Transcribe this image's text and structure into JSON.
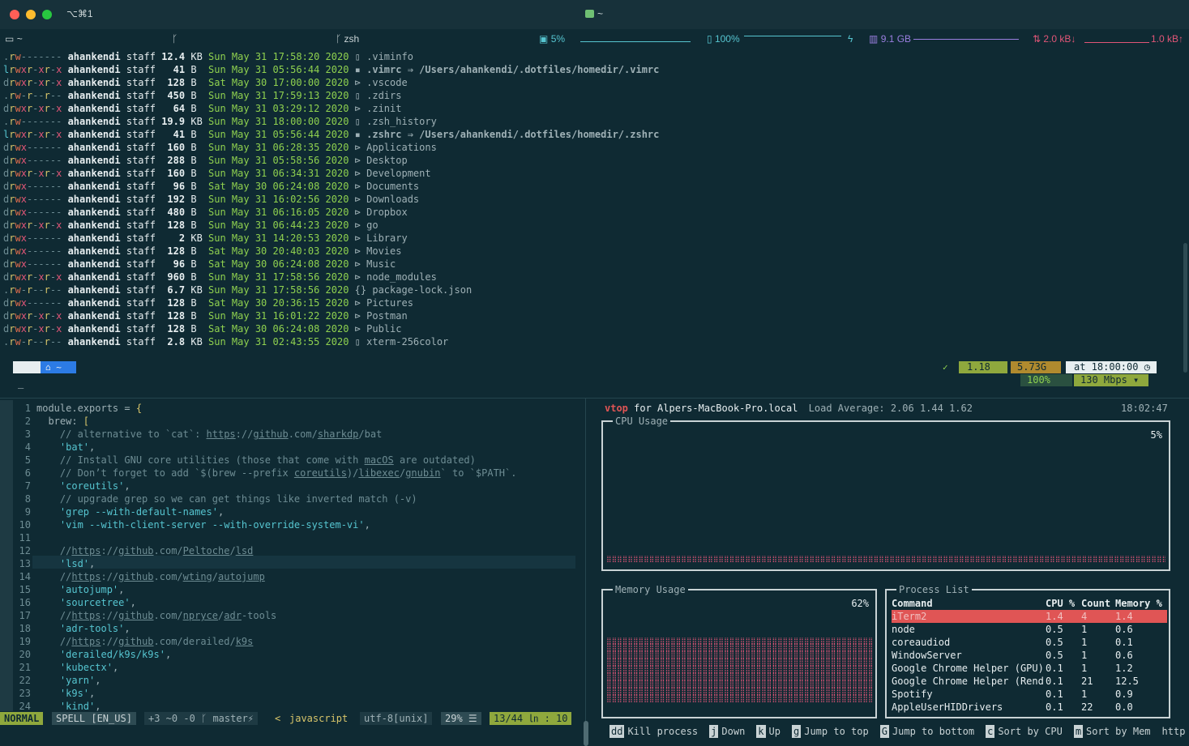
{
  "window": {
    "shortcut": "⌥⌘1",
    "title": "~"
  },
  "statusbar": {
    "cwd": "~",
    "shell": "zsh",
    "cpu": "5%",
    "battery": "100%",
    "memory": "9.1 GB",
    "net_down": "2.0 kB↓",
    "net_up": "1.0 kB↑",
    "colors": {
      "cpu": "#56c5d0",
      "battery": "#56c5d0",
      "memory": "#9a7fe0",
      "net": "#e05577"
    }
  },
  "listing": [
    {
      "perm": ".rw-------",
      "user": "ahankendi",
      "group": "staff",
      "size": "12.4",
      "unit": "KB",
      "date": "Sun May 31 17:58:20 2020",
      "icon": "file-icon",
      "name": ".viminfo",
      "target": ""
    },
    {
      "perm": "lrwxr-xr-x",
      "user": "ahankendi",
      "group": "staff",
      "size": "41",
      "unit": "B",
      "date": "Sun May 31 05:56:44 2020",
      "icon": "link-icon",
      "name": ".vimrc",
      "target": "⇒ /Users/ahankendi/.dotfiles/homedir/.vimrc"
    },
    {
      "perm": "drwxr-xr-x",
      "user": "ahankendi",
      "group": "staff",
      "size": "128",
      "unit": "B",
      "date": "Sat May 30 17:00:00 2020",
      "icon": "folder-icon",
      "name": ".vscode",
      "target": ""
    },
    {
      "perm": ".rw-r--r--",
      "user": "ahankendi",
      "group": "staff",
      "size": "450",
      "unit": "B",
      "date": "Sun May 31 17:59:13 2020",
      "icon": "file-icon",
      "name": ".zdirs",
      "target": ""
    },
    {
      "perm": "drwxr-xr-x",
      "user": "ahankendi",
      "group": "staff",
      "size": "64",
      "unit": "B",
      "date": "Sun May 31 03:29:12 2020",
      "icon": "folder-icon",
      "name": ".zinit",
      "target": ""
    },
    {
      "perm": ".rw-------",
      "user": "ahankendi",
      "group": "staff",
      "size": "19.9",
      "unit": "KB",
      "date": "Sun May 31 18:00:00 2020",
      "icon": "file-icon",
      "name": ".zsh_history",
      "target": ""
    },
    {
      "perm": "lrwxr-xr-x",
      "user": "ahankendi",
      "group": "staff",
      "size": "41",
      "unit": "B",
      "date": "Sun May 31 05:56:44 2020",
      "icon": "link-icon",
      "name": ".zshrc",
      "target": "⇒ /Users/ahankendi/.dotfiles/homedir/.zshrc"
    },
    {
      "perm": "drwx------",
      "user": "ahankendi",
      "group": "staff",
      "size": "160",
      "unit": "B",
      "date": "Sun May 31 06:28:35 2020",
      "icon": "folder-icon",
      "name": "Applications",
      "target": ""
    },
    {
      "perm": "drwx------",
      "user": "ahankendi",
      "group": "staff",
      "size": "288",
      "unit": "B",
      "date": "Sun May 31 05:58:56 2020",
      "icon": "folder-icon",
      "name": "Desktop",
      "target": ""
    },
    {
      "perm": "drwxr-xr-x",
      "user": "ahankendi",
      "group": "staff",
      "size": "160",
      "unit": "B",
      "date": "Sun May 31 06:34:31 2020",
      "icon": "folder-icon",
      "name": "Development",
      "target": ""
    },
    {
      "perm": "drwx------",
      "user": "ahankendi",
      "group": "staff",
      "size": "96",
      "unit": "B",
      "date": "Sat May 30 06:24:08 2020",
      "icon": "folder-icon",
      "name": "Documents",
      "target": ""
    },
    {
      "perm": "drwx------",
      "user": "ahankendi",
      "group": "staff",
      "size": "192",
      "unit": "B",
      "date": "Sun May 31 16:02:56 2020",
      "icon": "folder-icon",
      "name": "Downloads",
      "target": ""
    },
    {
      "perm": "drwx------",
      "user": "ahankendi",
      "group": "staff",
      "size": "480",
      "unit": "B",
      "date": "Sun May 31 06:16:05 2020",
      "icon": "folder-icon",
      "name": "Dropbox",
      "target": ""
    },
    {
      "perm": "drwxr-xr-x",
      "user": "ahankendi",
      "group": "staff",
      "size": "128",
      "unit": "B",
      "date": "Sun May 31 06:44:23 2020",
      "icon": "folder-icon",
      "name": "go",
      "target": ""
    },
    {
      "perm": "drwx------",
      "user": "ahankendi",
      "group": "staff",
      "size": "2",
      "unit": "KB",
      "date": "Sun May 31 14:20:53 2020",
      "icon": "folder-icon",
      "name": "Library",
      "target": ""
    },
    {
      "perm": "drwx------",
      "user": "ahankendi",
      "group": "staff",
      "size": "128",
      "unit": "B",
      "date": "Sat May 30 20:40:03 2020",
      "icon": "folder-icon",
      "name": "Movies",
      "target": ""
    },
    {
      "perm": "drwx------",
      "user": "ahankendi",
      "group": "staff",
      "size": "96",
      "unit": "B",
      "date": "Sat May 30 06:24:08 2020",
      "icon": "folder-icon",
      "name": "Music",
      "target": ""
    },
    {
      "perm": "drwxr-xr-x",
      "user": "ahankendi",
      "group": "staff",
      "size": "960",
      "unit": "B",
      "date": "Sun May 31 17:58:56 2020",
      "icon": "folder-icon",
      "name": "node_modules",
      "target": ""
    },
    {
      "perm": ".rw-r--r--",
      "user": "ahankendi",
      "group": "staff",
      "size": "6.7",
      "unit": "KB",
      "date": "Sun May 31 17:58:56 2020",
      "icon": "json-icon",
      "name": "package-lock.json",
      "target": ""
    },
    {
      "perm": "drwx------",
      "user": "ahankendi",
      "group": "staff",
      "size": "128",
      "unit": "B",
      "date": "Sat May 30 20:36:15 2020",
      "icon": "folder-icon",
      "name": "Pictures",
      "target": ""
    },
    {
      "perm": "drwxr-xr-x",
      "user": "ahankendi",
      "group": "staff",
      "size": "128",
      "unit": "B",
      "date": "Sun May 31 16:01:22 2020",
      "icon": "folder-icon",
      "name": "Postman",
      "target": ""
    },
    {
      "perm": "drwxr-xr-x",
      "user": "ahankendi",
      "group": "staff",
      "size": "128",
      "unit": "B",
      "date": "Sat May 30 06:24:08 2020",
      "icon": "folder-icon",
      "name": "Public",
      "target": ""
    },
    {
      "perm": ".rw-r--r--",
      "user": "ahankendi",
      "group": "staff",
      "size": "2.8",
      "unit": "KB",
      "date": "Sun May 31 02:43:55 2020",
      "icon": "file-icon",
      "name": "xterm-256color",
      "target": ""
    }
  ],
  "prompt": {
    "left_dir": "~",
    "right_load": "1.18",
    "right_mem": "5.73G",
    "right_time": "at 18:00:00",
    "right_battery": "100%",
    "right_net": "130 Mbps",
    "cursor": "_"
  },
  "editor": {
    "lines": [
      {
        "n": "1",
        "html": "module.exports = <span class='brk'>{</span>"
      },
      {
        "n": "2",
        "html": "  brew: <span class='brk'>[</span>"
      },
      {
        "n": "3",
        "html": "    <span class='cmt'>// alternative to `cat`: <span class='u'>https</span>://<span class='u'>github</span>.com/<span class='u'>sharkdp</span>/bat</span>"
      },
      {
        "n": "4",
        "html": "    <span class='str'>'bat'</span>,"
      },
      {
        "n": "5",
        "html": "    <span class='cmt'>// Install GNU core utilities (those that come with <span class='u'>macOS</span> are outdated)</span>"
      },
      {
        "n": "6",
        "html": "    <span class='cmt'>// Don’t forget to add `$(brew --prefix <span class='u'>coreutils</span>)/<span class='u'>libexec</span>/<span class='u'>gnubin</span>` to `$PATH`.</span>"
      },
      {
        "n": "7",
        "html": "    <span class='str'>'coreutils'</span>,"
      },
      {
        "n": "8",
        "html": "    <span class='cmt'>// upgrade grep so we can get things like inverted match (-v)</span>"
      },
      {
        "n": "9",
        "html": "    <span class='str'>'grep --with-default-names'</span>,"
      },
      {
        "n": "10",
        "html": "    <span class='str'>'vim --with-client-server --with-override-system-vi'</span>,"
      },
      {
        "n": "11",
        "html": ""
      },
      {
        "n": "12",
        "html": "    <span class='cmt'>//<span class='u'>https</span>://<span class='u'>github</span>.com/<span class='u'>Peltoche</span>/<span class='u'>lsd</span></span>"
      },
      {
        "n": "13",
        "html": "    <span class='str'>'lsd'</span>,"
      },
      {
        "n": "14",
        "html": "    <span class='cmt'>//<span class='u'>https</span>://<span class='u'>github</span>.com/<span class='u'>wting</span>/<span class='u'>autojump</span></span>"
      },
      {
        "n": "15",
        "html": "    <span class='str'>'autojump'</span>,"
      },
      {
        "n": "16",
        "html": "    <span class='str'>'sourcetree'</span>,"
      },
      {
        "n": "17",
        "html": "    <span class='cmt'>//<span class='u'>https</span>://<span class='u'>github</span>.com/<span class='u'>npryce</span>/<span class='u'>adr</span>-tools</span>"
      },
      {
        "n": "18",
        "html": "    <span class='str'>'adr-tools'</span>,"
      },
      {
        "n": "19",
        "html": "    <span class='cmt'>//<span class='u'>https</span>://<span class='u'>github</span>.com/derailed/<span class='u'>k9s</span></span>"
      },
      {
        "n": "20",
        "html": "    <span class='str'>'derailed/k9s/k9s'</span>,"
      },
      {
        "n": "21",
        "html": "    <span class='str'>'kubectx'</span>,"
      },
      {
        "n": "22",
        "html": "    <span class='str'>'yarn'</span>,"
      },
      {
        "n": "23",
        "html": "    <span class='str'>'k9s'</span>,"
      },
      {
        "n": "24",
        "html": "    <span class='str'>'kind'</span>,"
      }
    ],
    "status": {
      "mode": "NORMAL",
      "spell": "SPELL [EN_US]",
      "git": "+3 ~0 -0 ᚴ master⚡",
      "arrow": "<",
      "filetype": "javascript",
      "encoding": "utf-8[unix]",
      "percent": "29% ☰",
      "position": "13/44 ㏑ : 10"
    }
  },
  "vtop": {
    "title": "vtop",
    "host": "for Alpers-MacBook-Pro.local",
    "load": "Load Average: 2.06 1.44 1.62",
    "time": "18:02:47",
    "cpu_label": "CPU Usage",
    "cpu_value": "5%",
    "mem_label": "Memory Usage",
    "mem_value": "62%",
    "proc_label": "Process List",
    "proc_headers": {
      "command": "Command",
      "cpu": "CPU %",
      "count": "Count",
      "mem": "Memory %"
    },
    "processes": [
      {
        "command": "iTerm2",
        "cpu": "1.4",
        "count": "4",
        "mem": "1.4"
      },
      {
        "command": "node",
        "cpu": "0.5",
        "count": "1",
        "mem": "0.6"
      },
      {
        "command": "coreaudiod",
        "cpu": "0.5",
        "count": "1",
        "mem": "0.1"
      },
      {
        "command": "WindowServer",
        "cpu": "0.5",
        "count": "1",
        "mem": "0.6"
      },
      {
        "command": "Google Chrome Helper (GPU)",
        "cpu": "0.1",
        "count": "1",
        "mem": "1.2"
      },
      {
        "command": "Google Chrome Helper (Rend",
        "cpu": "0.1",
        "count": "21",
        "mem": "12.5"
      },
      {
        "command": "Spotify",
        "cpu": "0.1",
        "count": "1",
        "mem": "0.9"
      },
      {
        "command": "AppleUserHIDDrivers",
        "cpu": "0.1",
        "count": "22",
        "mem": "0.0"
      }
    ],
    "footer": [
      {
        "key": "dd",
        "label": "Kill process"
      },
      {
        "key": "j",
        "label": "Down"
      },
      {
        "key": "k",
        "label": "Up"
      },
      {
        "key": "g",
        "label": "Jump to top"
      },
      {
        "key": "G",
        "label": "Jump to bottom"
      },
      {
        "key": "c",
        "label": "Sort by CPU"
      },
      {
        "key": "m",
        "label": "Sort by Mem"
      }
    ],
    "footer_tail": "http"
  }
}
